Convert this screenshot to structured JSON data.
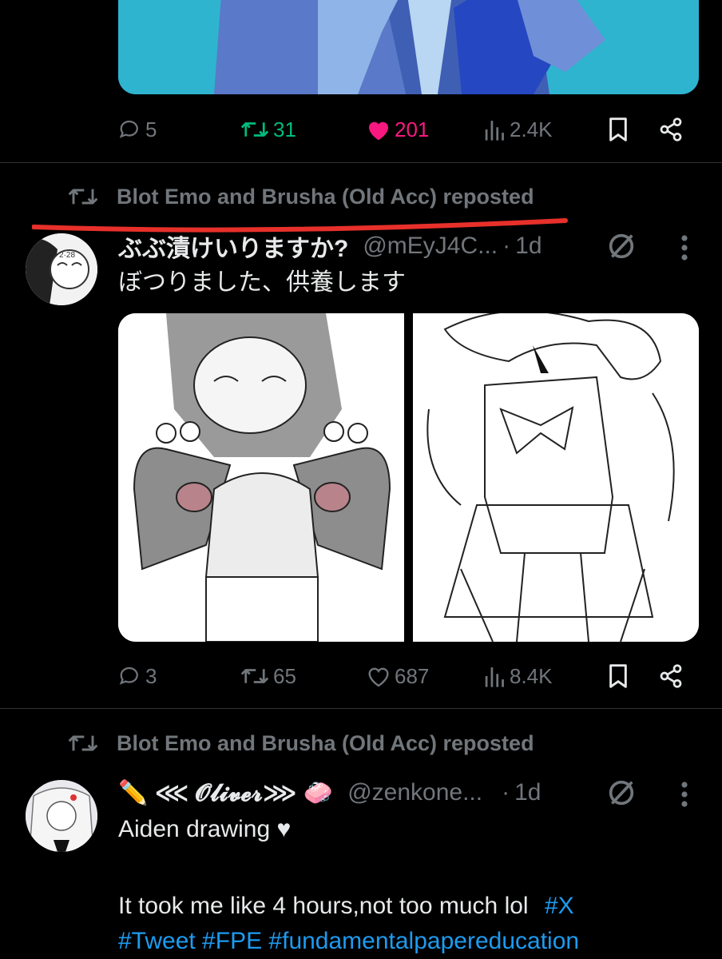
{
  "top_tweet": {
    "actions": {
      "replies": "5",
      "reposts": "31",
      "likes": "201",
      "views": "2.4K"
    },
    "colors": {
      "repost_active": "#00ba7c",
      "like_active": "#f91880"
    }
  },
  "tweet1": {
    "repost_label": "Blot Emo and Brusha (Old Acc) reposted",
    "display_name": "ぶぶ漬けいりますか?",
    "handle": "@mEyJ4C...",
    "time": "1d",
    "text": "ぼつりました、供養します",
    "actions": {
      "replies": "3",
      "reposts": "65",
      "likes": "687",
      "views": "8.4K"
    }
  },
  "tweet2": {
    "repost_label": "Blot Emo and Brusha (Old Acc) reposted",
    "display_name": "✏️ ⋘ 𝓞𝓵𝓲𝓿𝓮𝓻⋙ 🧼",
    "handle": "@zenkone...",
    "time": "1d",
    "text_line1": "Aiden drawing ♥",
    "text_line2": "It took me like 4 hours,not too much lol",
    "hashtags_line2": "#X",
    "hashtags_line3": "#Tweet #FPE #fundamentalpapereducation"
  },
  "icons": [
    "reply-icon",
    "repost-icon",
    "like-icon",
    "views-icon",
    "bookmark-icon",
    "share-icon",
    "grok-icon",
    "more-icon"
  ]
}
